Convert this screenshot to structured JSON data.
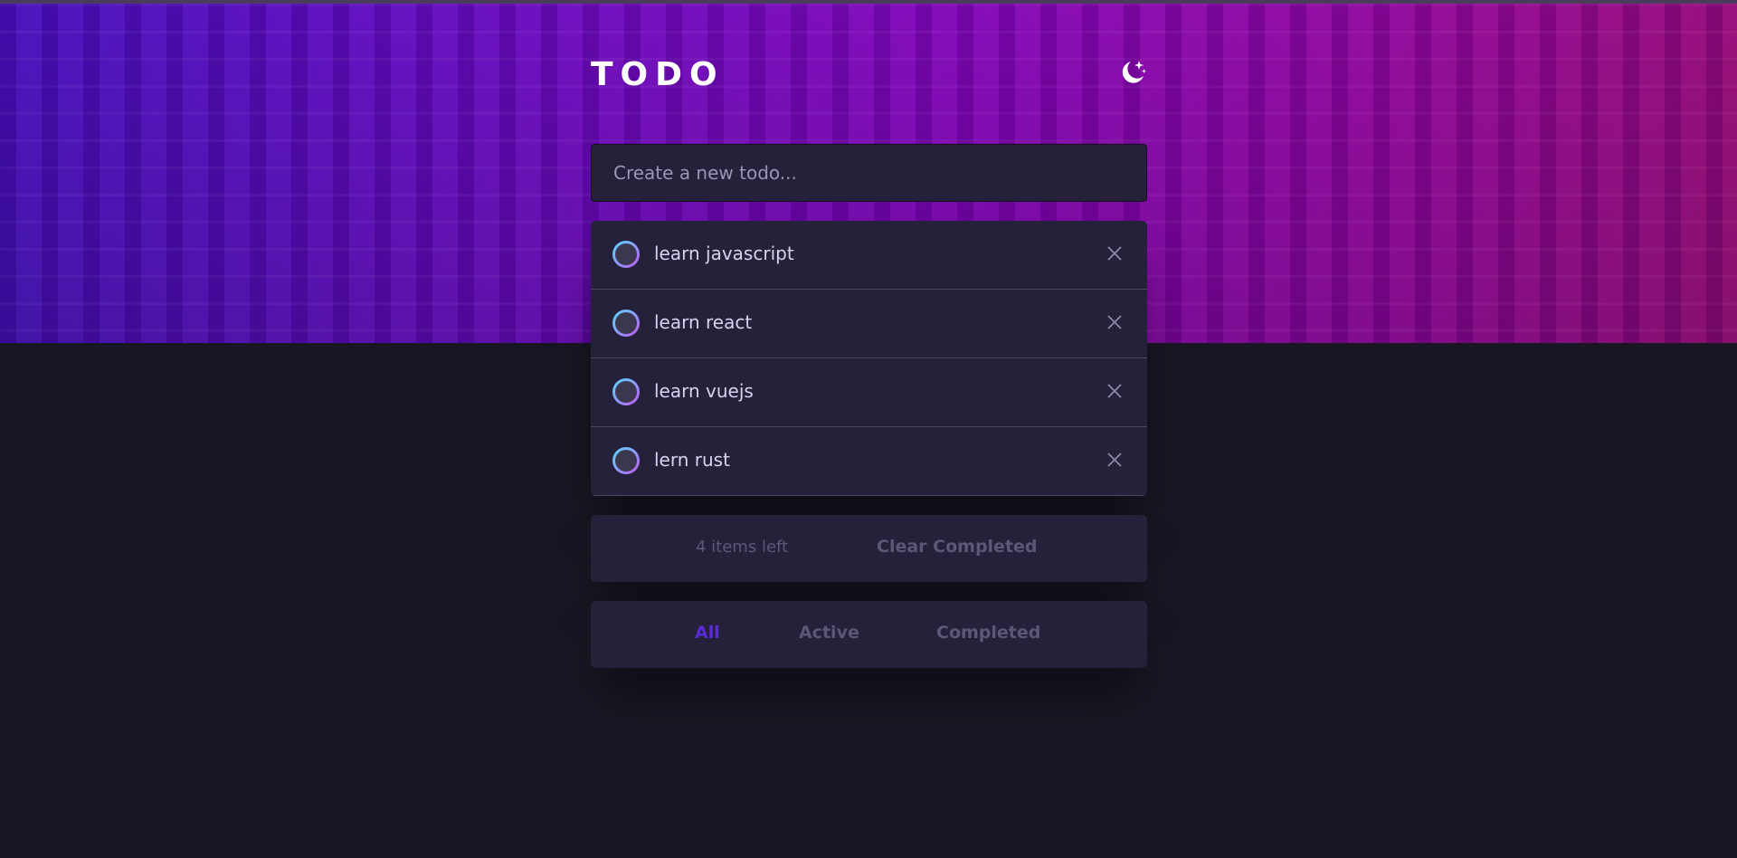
{
  "app": {
    "title": "TODO",
    "theme_icon": "moon-stars-icon"
  },
  "new_todo": {
    "placeholder": "Create a new todo...",
    "value": ""
  },
  "todos": [
    {
      "text": "learn javascript",
      "completed": false
    },
    {
      "text": "learn react",
      "completed": false
    },
    {
      "text": "learn vuejs",
      "completed": false
    },
    {
      "text": "lern rust",
      "completed": false
    }
  ],
  "footer": {
    "items_left": "4 items left",
    "clear_completed": "Clear Completed"
  },
  "filters": {
    "all": "All",
    "active": "Active",
    "completed": "Completed",
    "selected": "all"
  },
  "colors": {
    "accent": "#5b2bd6",
    "check_gradient_start": "#57ddff",
    "check_gradient_end": "#c058f3",
    "card_bg": "#25213b",
    "page_bg": "#171622"
  }
}
